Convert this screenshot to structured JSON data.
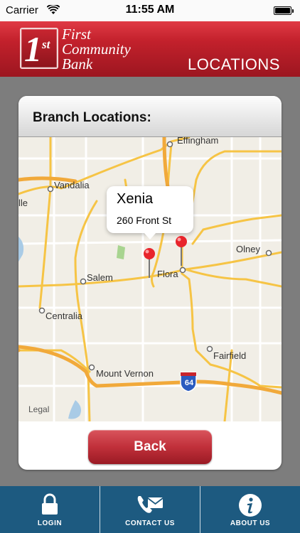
{
  "status_bar": {
    "carrier": "Carrier",
    "time": "11:55 AM"
  },
  "header": {
    "logo": {
      "number": "1",
      "suffix": "st",
      "line1": "First",
      "line2": "Community",
      "line3": "Bank"
    },
    "title": "LOCATIONS"
  },
  "card": {
    "title": "Branch Locations:"
  },
  "map": {
    "towns": [
      "Effingham",
      "Vandalia",
      "lle",
      "Olney",
      "Flora",
      "Salem",
      "Centralia",
      "Fairfield",
      "Mount Vernon"
    ],
    "shield": "64",
    "legal": "Legal",
    "callout": {
      "title": "Xenia",
      "subtitle": "260 Front St"
    }
  },
  "back_button": {
    "label": "Back"
  },
  "tab_bar": {
    "items": [
      {
        "label": "LOGIN",
        "icon": "lock-icon"
      },
      {
        "label": "CONTACT US",
        "icon": "phone-mail-icon"
      },
      {
        "label": "ABOUT US",
        "icon": "info-icon"
      }
    ]
  },
  "colors": {
    "brand_red": "#c3212c",
    "tab_blue": "#1d5a80",
    "map_bg": "#f1eee6",
    "road_yellow": "#f6c445"
  }
}
